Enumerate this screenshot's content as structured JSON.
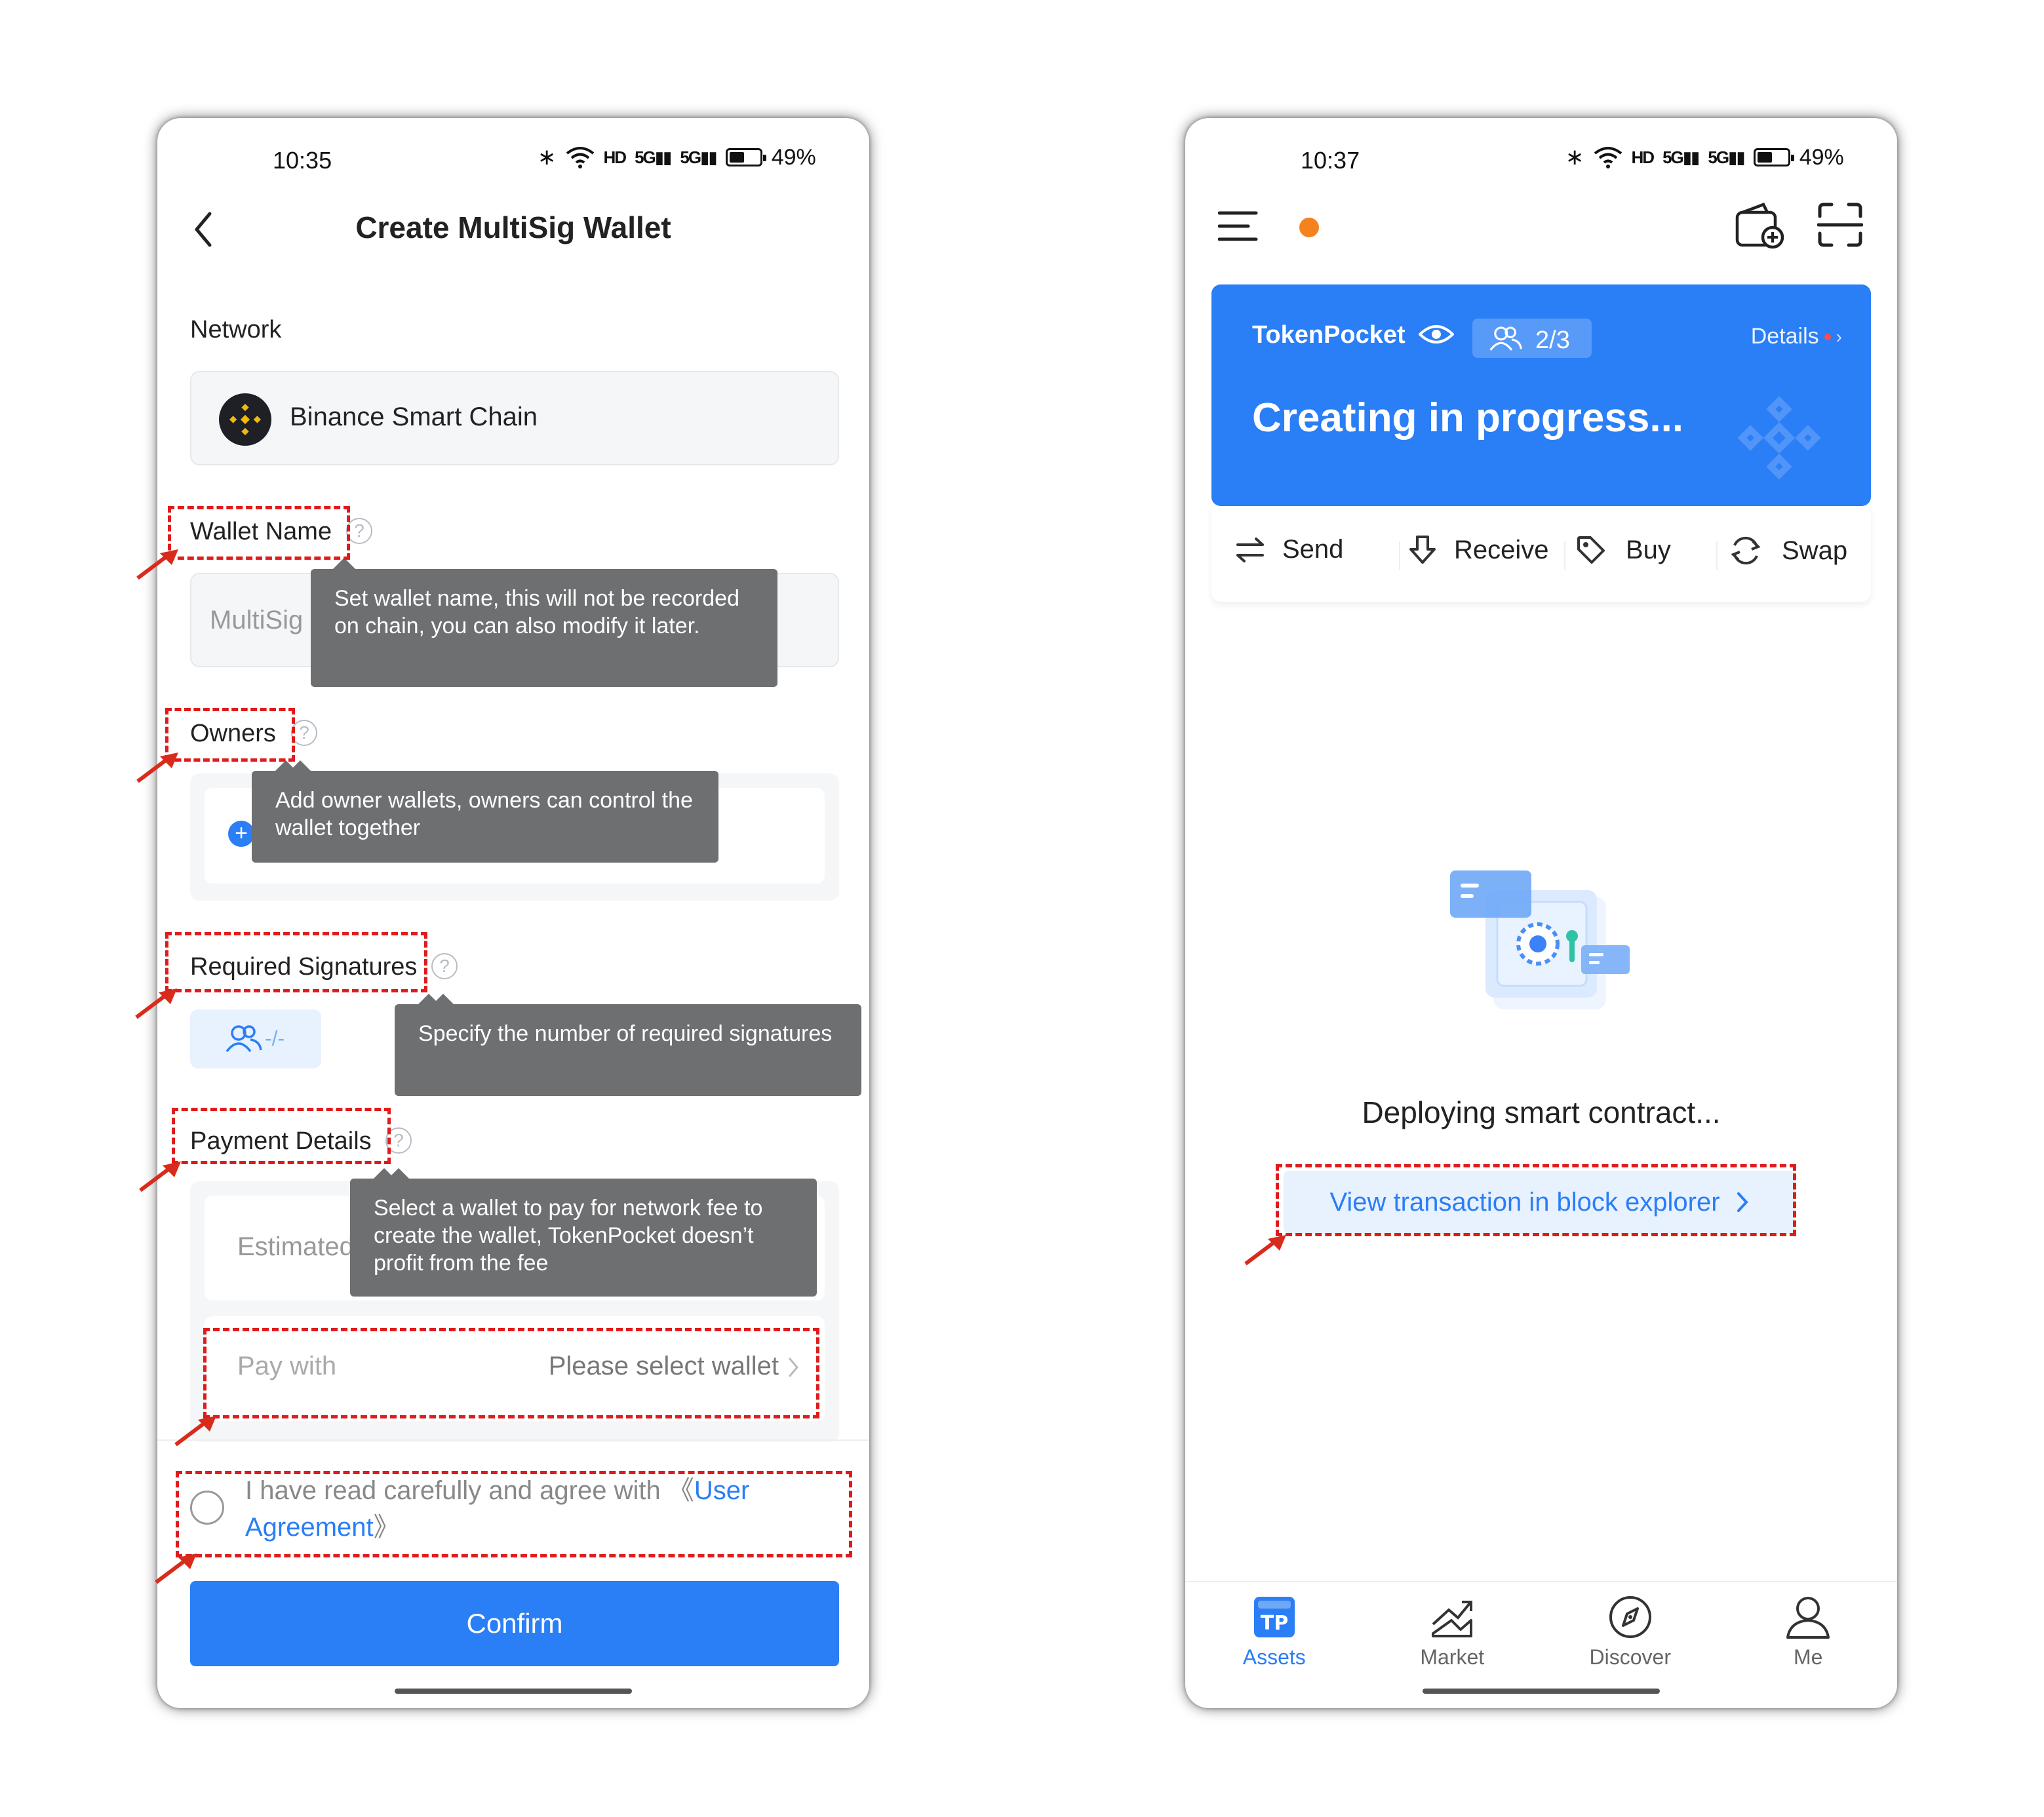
{
  "left_phone": {
    "status": {
      "time": "10:35",
      "battery": "49%"
    },
    "title": "Create MultiSig Wallet",
    "network": {
      "label": "Network",
      "value": "Binance Smart Chain"
    },
    "wallet_name": {
      "label": "Wallet Name",
      "placeholder": "MultiSig",
      "tooltip": "Set wallet name, this will not be recorded on chain, you can also modify it later."
    },
    "owners": {
      "label": "Owners",
      "tooltip": "Add owner wallets, owners can control the wallet together"
    },
    "required_signatures": {
      "label": "Required Signatures",
      "value": "-/-",
      "tooltip": "Specify the number of required signatures"
    },
    "payment_details": {
      "label": "Payment Details",
      "estimate_label": "Estimated",
      "tooltip": "Select a wallet to pay for network fee to create the wallet, TokenPocket doesn’t profit from the fee",
      "pay_with_label": "Pay with",
      "pay_with_value": "Please select wallet"
    },
    "agreement": {
      "text": "I have read carefully and agree with 《",
      "link": "User Agreement",
      "suffix": "》"
    },
    "confirm_label": "Confirm"
  },
  "right_phone": {
    "status": {
      "time": "10:37",
      "battery": "49%"
    },
    "card": {
      "wallet_name": "TokenPocket",
      "owners_count": "2/3",
      "details_label": "Details",
      "status_text": "Creating in progress..."
    },
    "actions": [
      {
        "label": "Send",
        "icon": "transfer-arrows-icon"
      },
      {
        "label": "Receive",
        "icon": "download-arrow-icon"
      },
      {
        "label": "Buy",
        "icon": "tag-icon"
      },
      {
        "label": "Swap",
        "icon": "swap-cycle-icon"
      }
    ],
    "deploy_text": "Deploying smart contract...",
    "explorer_link": "View transaction in block explorer",
    "bottom_nav": [
      {
        "label": "Assets",
        "icon": "tp-logo-icon",
        "active": true
      },
      {
        "label": "Market",
        "icon": "market-chart-icon",
        "active": false
      },
      {
        "label": "Discover",
        "icon": "compass-icon",
        "active": false
      },
      {
        "label": "Me",
        "icon": "person-icon",
        "active": false
      }
    ]
  },
  "colors": {
    "primary_blue": "#2a7ef6",
    "link_blue": "#2a7ef6",
    "binance_yellow": "#f0b90b",
    "tooltip_bg": "#6e6f71",
    "highlight_red": "#e01b1b",
    "notification_orange": "#f5821f"
  }
}
